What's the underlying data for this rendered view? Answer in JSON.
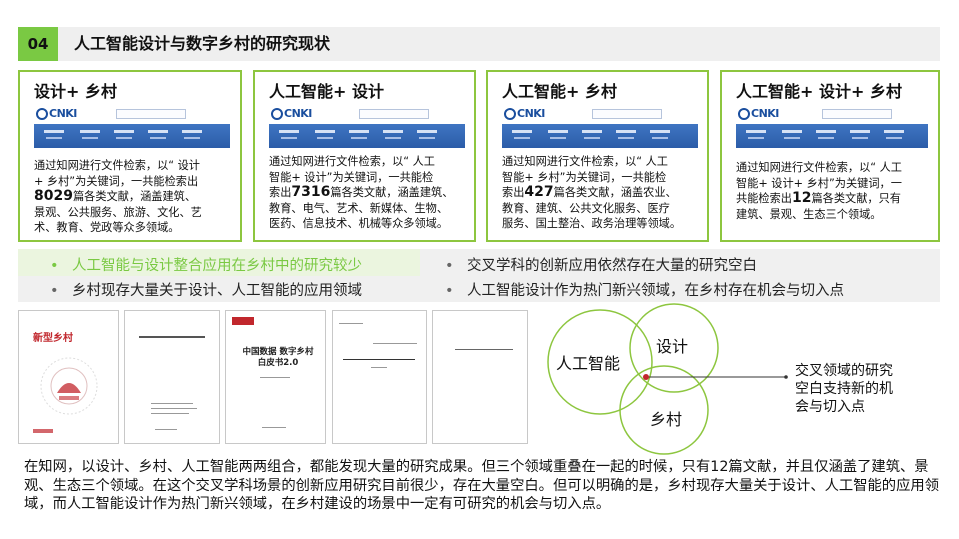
{
  "header": {
    "number": "04",
    "title": "人工智能设计与数字乡村的研究现状"
  },
  "cards": [
    {
      "title": "设计+ 乡村",
      "lines": [
        "通过知网进行文件检索，以“ 设计",
        "+ 乡村”为关键词，一共能检索出"
      ],
      "count": "8029",
      "count_suffix": "篇各类文献，涵盖建筑、",
      "tail": [
        "景观、公共服务、旅游、文化、艺",
        "术、教育、党政等众多领域。"
      ]
    },
    {
      "title": "人工智能+ 设计",
      "lines": [
        "通过知网进行文件检索，以“ 人工",
        "智能+ 设计”为关键词，一共能检"
      ],
      "count_prefix": "索出",
      "count": "7316",
      "count_suffix": "篇各类文献，涵盖建筑、",
      "tail": [
        "教育、电气、艺术、新媒体、生物、",
        "医药、信息技术、机械等众多领域。"
      ]
    },
    {
      "title": "人工智能+ 乡村",
      "lines": [
        "通过知网进行文件检索，以“ 人工",
        "智能+ 乡村”为关键词，一共能检"
      ],
      "count_prefix": "索出",
      "count": "427",
      "count_suffix": "篇各类文献，涵盖农业、",
      "tail": [
        "教育、建筑、公共文化服务、医疗",
        "服务、国土整治、政务治理等领域。"
      ]
    },
    {
      "title": "人工智能+ 设计+ 乡村",
      "lines": [
        "通过知网进行文件检索，以“ 人工",
        "智能+ 设计+ 乡村”为关键词，一"
      ],
      "count_prefix": "共能检索出",
      "count": "12",
      "count_suffix": "篇各类文献，只有",
      "tail": [
        "建筑、景观、生态三个领域。"
      ]
    }
  ],
  "bullets": {
    "b1": "人工智能与设计整合应用在乡村中的研究较少",
    "b2": "乡村现存大量关于设计、人工智能的应用领域",
    "b3": "交叉学科的创新应用依然存在大量的研究空白",
    "b4": "人工智能设计作为热门新兴领域，在乡村存在机会与切入点",
    "dot": "•"
  },
  "documents": [
    {
      "title": "新型乡村"
    },
    {
      "title": ""
    },
    {
      "title": "中国数据 数字乡村白皮书2.0"
    },
    {
      "title": ""
    },
    {
      "title": ""
    }
  ],
  "venn": {
    "ai": "人工智能",
    "design": "设计",
    "village": "乡村",
    "note": [
      "交叉领域的研究",
      "空白支持新的机",
      "会与切入点"
    ]
  },
  "paragraph": "在知网，以设计、乡村、人工智能两两组合，都能发现大量的研究成果。但三个领域重叠在一起的时候，只有12篇文献，并且仅涵盖了建筑、景观、生态三个领域。在这个交叉学科场景的创新应用研究目前很少，存在大量空白。但可以明确的是，乡村现存大量关于设计、人工智能的应用领域，而人工智能设计作为热门新兴领域，在乡村建设的场景中一定有可研究的机会与切入点。",
  "colors": {
    "accent": "#7ac943",
    "card_border": "#8dc63f",
    "cnki_blue": "#2b5ca8",
    "red_dot": "#c1272d"
  }
}
